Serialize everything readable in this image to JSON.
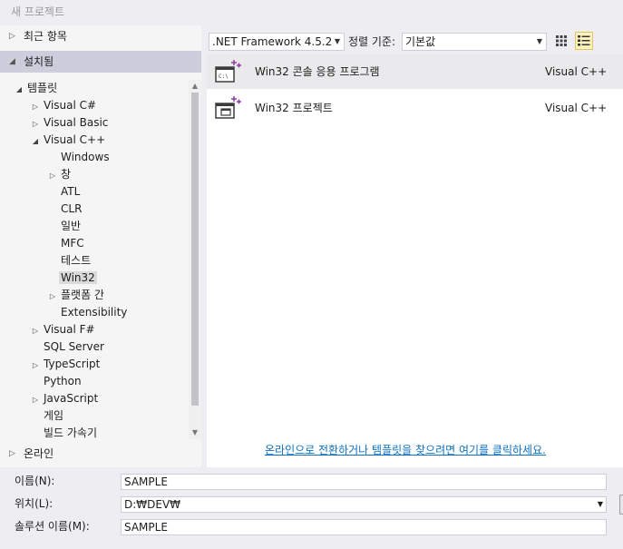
{
  "dialog": {
    "title": "새 프로젝트"
  },
  "left": {
    "recent": "최근 항목",
    "installed": "설치됨",
    "online": "온라인",
    "tree": [
      {
        "label": "템플릿",
        "expander": "◢"
      },
      {
        "label": "Visual C#",
        "expander": "▷"
      },
      {
        "label": "Visual Basic",
        "expander": "▷"
      },
      {
        "label": "Visual C++",
        "expander": "◢"
      },
      {
        "label": "Windows",
        "expander": ""
      },
      {
        "label": "창",
        "expander": "▷"
      },
      {
        "label": "ATL",
        "expander": ""
      },
      {
        "label": "CLR",
        "expander": ""
      },
      {
        "label": "일반",
        "expander": ""
      },
      {
        "label": "MFC",
        "expander": ""
      },
      {
        "label": "테스트",
        "expander": ""
      },
      {
        "label": "Win32",
        "expander": ""
      },
      {
        "label": "플랫폼 간",
        "expander": "▷"
      },
      {
        "label": "Extensibility",
        "expander": ""
      },
      {
        "label": "Visual F#",
        "expander": "▷"
      },
      {
        "label": "SQL Server",
        "expander": ""
      },
      {
        "label": "TypeScript",
        "expander": "▷"
      },
      {
        "label": "Python",
        "expander": ""
      },
      {
        "label": "JavaScript",
        "expander": "▷"
      },
      {
        "label": "게임",
        "expander": ""
      },
      {
        "label": "빌드 가속기",
        "expander": ""
      }
    ],
    "selected": "Win32"
  },
  "toolbar": {
    "framework": ".NET Framework 4.5.2",
    "sort_label": "정렬 기준:",
    "sort_value": "기본값"
  },
  "templates": [
    {
      "name": "Win32 콘솔 응용 프로그램",
      "lang": "Visual C++",
      "icon": "console-app-icon"
    },
    {
      "name": "Win32 프로젝트",
      "lang": "Visual C++",
      "icon": "win32-project-icon"
    }
  ],
  "online_link": "온라인으로 전환하거나 템플릿을 찾으려면 여기를 클릭하세요.",
  "form": {
    "name_label": "이름(N):",
    "name_value": "SAMPLE",
    "location_label": "위치(L):",
    "location_value": "D:₩DEV₩",
    "solution_label": "솔루션 이름(M):",
    "solution_value": "SAMPLE"
  },
  "colors": {
    "accent": "#0e70c0",
    "selection": "#cccedb",
    "icon_plus": "#8a3ca8"
  }
}
